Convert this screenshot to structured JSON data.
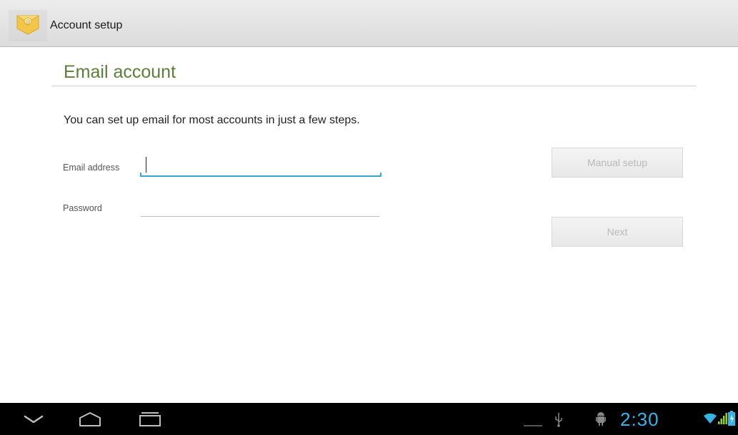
{
  "action_bar": {
    "title": "Account setup",
    "app_icon": "email-app-icon"
  },
  "page": {
    "title": "Email account",
    "intro": "You can set up email for most accounts in just a few steps."
  },
  "form": {
    "email_label": "Email address",
    "email_value": "",
    "password_label": "Password",
    "password_value": ""
  },
  "buttons": {
    "manual_setup": "Manual setup",
    "next": "Next"
  },
  "system_bar": {
    "time": "2:30",
    "nav_icons": [
      "back-icon",
      "home-icon",
      "recent-apps-icon"
    ],
    "status_icons": [
      "dash-icon",
      "usb-icon",
      "android-debug-icon",
      "wifi-icon",
      "signal-icon",
      "battery-icon"
    ]
  },
  "colors": {
    "accent_green": "#5b7f3a",
    "focus_blue": "#33b5e5",
    "bar_black": "#000000"
  }
}
